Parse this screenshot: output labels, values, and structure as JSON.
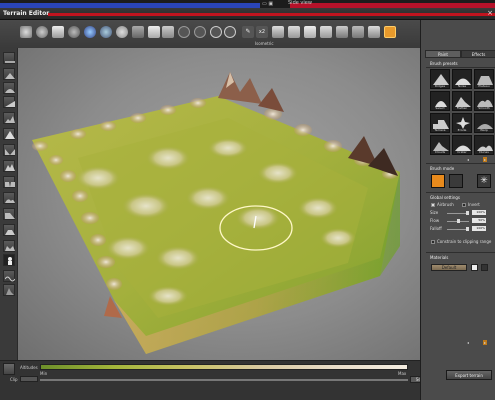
{
  "window": {
    "top_side_view": "Side view",
    "title": "Terrain Editor",
    "close": "×"
  },
  "toolbar": {
    "caption": "Isometric",
    "zoom_label": "x2"
  },
  "panel": {
    "tabs": [
      "Paint",
      "Effects"
    ],
    "brush_presets_title": "Brush presets",
    "presets": [
      "Ridges",
      "Noise",
      "Plateau",
      "Select",
      "Flatten",
      "Smooth",
      "Terrace",
      "Erode",
      "Warp",
      "Clouds",
      "Crater",
      "Dunes"
    ],
    "pager_left": "◂",
    "pager_right": "▸",
    "brush_mode_title": "Brush mode",
    "global_settings_title": "Global settings",
    "airbrush_label": "Airbrush",
    "invert_label": "Invert",
    "size_label": "Size",
    "size_value": "100%",
    "flow_label": "Flow",
    "flow_value": "50%",
    "falloff_label": "Falloff",
    "falloff_value": "100%",
    "constrain_label": "Constrain to clipping range",
    "materials_title": "Materials",
    "material_value": "Default",
    "export_label": "Export terrain"
  },
  "bottom": {
    "altitudes_label": "Altitudes",
    "min_label": "Min",
    "max_label": "Max",
    "clip_label": "Clip",
    "clip_button": "Set"
  },
  "colors": {
    "accent": "#e89a2c",
    "title_red": "#c0141f",
    "top_blue": "#2a45b8"
  }
}
